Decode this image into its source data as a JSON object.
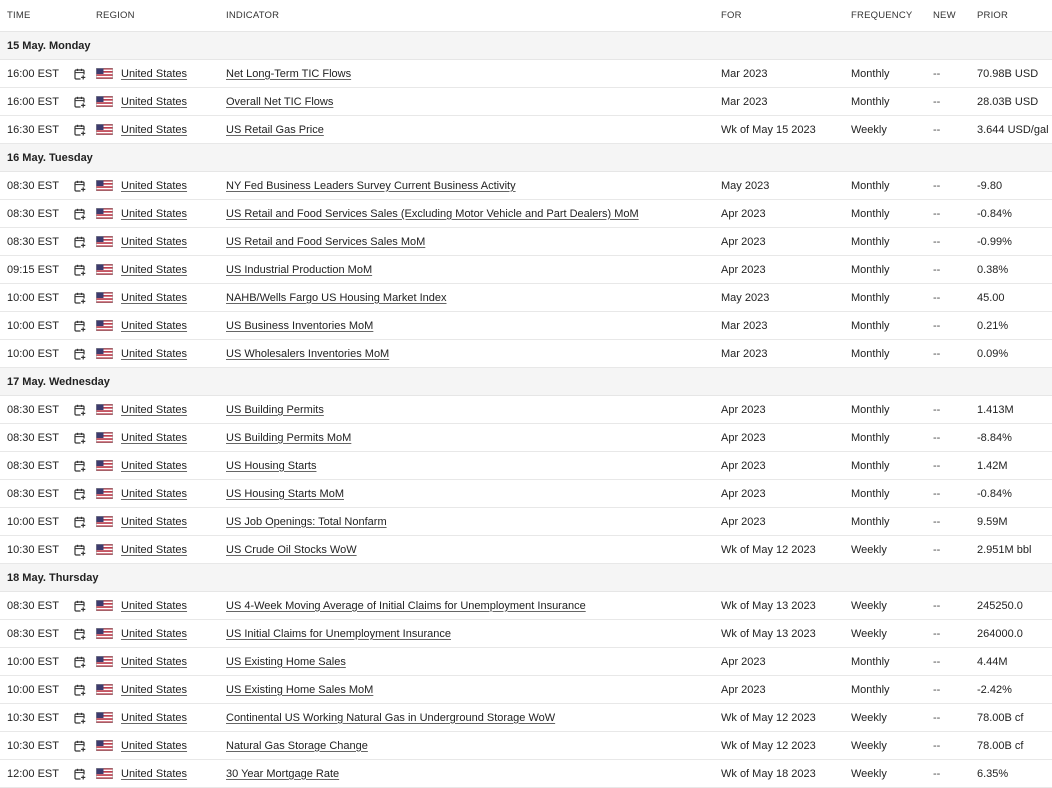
{
  "headers": {
    "time": "TIME",
    "region": "REGION",
    "indicator": "INDICATOR",
    "for": "FOR",
    "frequency": "FREQUENCY",
    "new": "NEW",
    "prior": "PRIOR"
  },
  "days": [
    {
      "label": "15 May. Monday",
      "events": [
        {
          "time": "16:00 EST",
          "region": "United States",
          "indicator": "Net Long-Term TIC Flows",
          "for": "Mar 2023",
          "frequency": "Monthly",
          "new": "--",
          "prior": "70.98B USD"
        },
        {
          "time": "16:00 EST",
          "region": "United States",
          "indicator": "Overall Net TIC Flows",
          "for": "Mar 2023",
          "frequency": "Monthly",
          "new": "--",
          "prior": "28.03B USD"
        },
        {
          "time": "16:30 EST",
          "region": "United States",
          "indicator": "US Retail Gas Price",
          "for": "Wk of May 15 2023",
          "frequency": "Weekly",
          "new": "--",
          "prior": "3.644 USD/gal"
        }
      ]
    },
    {
      "label": "16 May. Tuesday",
      "events": [
        {
          "time": "08:30 EST",
          "region": "United States",
          "indicator": "NY Fed Business Leaders Survey Current Business Activity",
          "for": "May 2023",
          "frequency": "Monthly",
          "new": "--",
          "prior": "-9.80"
        },
        {
          "time": "08:30 EST",
          "region": "United States",
          "indicator": "US Retail and Food Services Sales (Excluding Motor Vehicle and Part Dealers) MoM",
          "for": "Apr 2023",
          "frequency": "Monthly",
          "new": "--",
          "prior": "-0.84%"
        },
        {
          "time": "08:30 EST",
          "region": "United States",
          "indicator": "US Retail and Food Services Sales MoM",
          "for": "Apr 2023",
          "frequency": "Monthly",
          "new": "--",
          "prior": "-0.99%"
        },
        {
          "time": "09:15 EST",
          "region": "United States",
          "indicator": "US Industrial Production MoM",
          "for": "Apr 2023",
          "frequency": "Monthly",
          "new": "--",
          "prior": "0.38%"
        },
        {
          "time": "10:00 EST",
          "region": "United States",
          "indicator": "NAHB/Wells Fargo US Housing Market Index",
          "for": "May 2023",
          "frequency": "Monthly",
          "new": "--",
          "prior": "45.00"
        },
        {
          "time": "10:00 EST",
          "region": "United States",
          "indicator": "US Business Inventories MoM",
          "for": "Mar 2023",
          "frequency": "Monthly",
          "new": "--",
          "prior": "0.21%"
        },
        {
          "time": "10:00 EST",
          "region": "United States",
          "indicator": "US Wholesalers Inventories MoM",
          "for": "Mar 2023",
          "frequency": "Monthly",
          "new": "--",
          "prior": "0.09%"
        }
      ]
    },
    {
      "label": "17 May. Wednesday",
      "events": [
        {
          "time": "08:30 EST",
          "region": "United States",
          "indicator": "US Building Permits",
          "for": "Apr 2023",
          "frequency": "Monthly",
          "new": "--",
          "prior": "1.413M"
        },
        {
          "time": "08:30 EST",
          "region": "United States",
          "indicator": "US Building Permits MoM",
          "for": "Apr 2023",
          "frequency": "Monthly",
          "new": "--",
          "prior": "-8.84%"
        },
        {
          "time": "08:30 EST",
          "region": "United States",
          "indicator": "US Housing Starts",
          "for": "Apr 2023",
          "frequency": "Monthly",
          "new": "--",
          "prior": "1.42M"
        },
        {
          "time": "08:30 EST",
          "region": "United States",
          "indicator": "US Housing Starts MoM",
          "for": "Apr 2023",
          "frequency": "Monthly",
          "new": "--",
          "prior": "-0.84%"
        },
        {
          "time": "10:00 EST",
          "region": "United States",
          "indicator": "US Job Openings: Total Nonfarm",
          "for": "Apr 2023",
          "frequency": "Monthly",
          "new": "--",
          "prior": "9.59M"
        },
        {
          "time": "10:30 EST",
          "region": "United States",
          "indicator": "US Crude Oil Stocks WoW",
          "for": "Wk of May 12 2023",
          "frequency": "Weekly",
          "new": "--",
          "prior": "2.951M bbl"
        }
      ]
    },
    {
      "label": "18 May. Thursday",
      "events": [
        {
          "time": "08:30 EST",
          "region": "United States",
          "indicator": "US 4-Week Moving Average of Initial Claims for Unemployment Insurance",
          "for": "Wk of May 13 2023",
          "frequency": "Weekly",
          "new": "--",
          "prior": "245250.0"
        },
        {
          "time": "08:30 EST",
          "region": "United States",
          "indicator": "US Initial Claims for Unemployment Insurance",
          "for": "Wk of May 13 2023",
          "frequency": "Weekly",
          "new": "--",
          "prior": "264000.0"
        },
        {
          "time": "10:00 EST",
          "region": "United States",
          "indicator": "US Existing Home Sales",
          "for": "Apr 2023",
          "frequency": "Monthly",
          "new": "--",
          "prior": "4.44M"
        },
        {
          "time": "10:00 EST",
          "region": "United States",
          "indicator": "US Existing Home Sales MoM",
          "for": "Apr 2023",
          "frequency": "Monthly",
          "new": "--",
          "prior": "-2.42%"
        },
        {
          "time": "10:30 EST",
          "region": "United States",
          "indicator": "Continental US Working Natural Gas in Underground Storage WoW",
          "for": "Wk of May 12 2023",
          "frequency": "Weekly",
          "new": "--",
          "prior": "78.00B cf"
        },
        {
          "time": "10:30 EST",
          "region": "United States",
          "indicator": "Natural Gas Storage Change",
          "for": "Wk of May 12 2023",
          "frequency": "Weekly",
          "new": "--",
          "prior": "78.00B cf"
        },
        {
          "time": "12:00 EST",
          "region": "United States",
          "indicator": "30 Year Mortgage Rate",
          "for": "Wk of May 18 2023",
          "frequency": "Weekly",
          "new": "--",
          "prior": "6.35%"
        }
      ]
    }
  ],
  "icons": {
    "calendar": "calendar-add-icon",
    "flag": "us-flag-icon"
  }
}
